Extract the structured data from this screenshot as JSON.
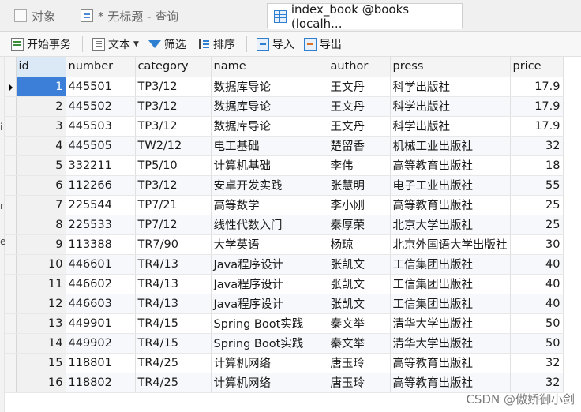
{
  "tabs": [
    {
      "label": "对象",
      "icon": "objects-icon"
    },
    {
      "label": "* 无标题 - 查询",
      "icon": "query-icon"
    },
    {
      "label": "index_book @books (localh...",
      "icon": "table-grid-icon"
    }
  ],
  "toolbar": {
    "begin_transaction": "开始事务",
    "text": "文本",
    "filter": "筛选",
    "sort": "排序",
    "import": "导入",
    "export": "导出"
  },
  "left_strip_chars": [
    "i",
    "r",
    "e"
  ],
  "table": {
    "columns": [
      "id",
      "number",
      "category",
      "name",
      "author",
      "press",
      "price"
    ],
    "rows": [
      [
        "1",
        "445501",
        "TP3/12",
        "数据库导论",
        "王文丹",
        "科学出版社",
        "17.9"
      ],
      [
        "2",
        "445502",
        "TP3/12",
        "数据库导论",
        "王文丹",
        "科学出版社",
        "17.9"
      ],
      [
        "3",
        "445503",
        "TP3/12",
        "数据库导论",
        "王文丹",
        "科学出版社",
        "17.9"
      ],
      [
        "4",
        "445505",
        "TW2/12",
        "电工基础",
        "楚留香",
        "机械工业出版社",
        "32"
      ],
      [
        "5",
        "332211",
        "TP5/10",
        "计算机基础",
        "李伟",
        "高等教育出版社",
        "18"
      ],
      [
        "6",
        "112266",
        "TP3/12",
        "安卓开发实践",
        "张慧明",
        "电子工业出版社",
        "55"
      ],
      [
        "7",
        "225544",
        "TP7/21",
        "高等数学",
        "李小刚",
        "高等教育出版社",
        "25"
      ],
      [
        "8",
        "225533",
        "TP7/12",
        "线性代数入门",
        "秦厚荣",
        "北京大学出版社",
        "25"
      ],
      [
        "9",
        "113388",
        "TR7/90",
        "大学英语",
        "杨琼",
        "北京外国语大学出版社",
        "30"
      ],
      [
        "10",
        "446601",
        "TR4/13",
        "Java程序设计",
        "张凯文",
        "工信集团出版社",
        "40"
      ],
      [
        "11",
        "446602",
        "TR4/13",
        "Java程序设计",
        "张凯文",
        "工信集团出版社",
        "40"
      ],
      [
        "12",
        "446603",
        "TR4/13",
        "Java程序设计",
        "张凯文",
        "工信集团出版社",
        "40"
      ],
      [
        "13",
        "449901",
        "TR4/15",
        "Spring Boot实践",
        "秦文举",
        "清华大学出版社",
        "50"
      ],
      [
        "14",
        "449902",
        "TR4/15",
        "Spring Boot实践",
        "秦文举",
        "清华大学出版社",
        "50"
      ],
      [
        "15",
        "118801",
        "TR4/25",
        "计算机网络",
        "唐玉玲",
        "高等教育出版社",
        "32"
      ],
      [
        "16",
        "118802",
        "TR4/25",
        "计算机网络",
        "唐玉玲",
        "高等教育出版社",
        "32"
      ]
    ]
  },
  "selection": {
    "row": 1,
    "column": "id"
  },
  "watermark": "CSDN @傲娇御小剑",
  "colors": {
    "selection": "#3c7fd8",
    "accent": "#2f7fd1"
  }
}
